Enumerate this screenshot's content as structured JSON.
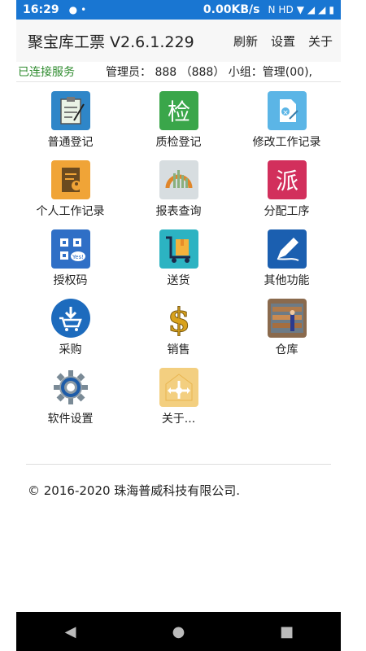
{
  "status_bar": {
    "time": "16:29",
    "speed": "0.00KB/s",
    "icons": [
      "chat-icon",
      "nfc-icon",
      "hd-icon",
      "wifi-icon",
      "signal-4g-icon",
      "signal-4g-icon-2",
      "battery-icon"
    ]
  },
  "app_bar": {
    "title": "聚宝库工票 V2.6.1.229",
    "refresh": "刷新",
    "settings": "设置",
    "about": "关于"
  },
  "info_bar": {
    "connection": "已连接服务",
    "admin": "管理员：  888 （888） 小组：管理(00),"
  },
  "menu": [
    {
      "label": "普通登记",
      "icon": "clipboard-icon",
      "bg": "#2f86c8"
    },
    {
      "label": "质检登记",
      "icon": "inspect-icon",
      "bg": "#3aa64a"
    },
    {
      "label": "修改工作记录",
      "icon": "edit-doc-icon",
      "bg": "#5bb5e6"
    },
    {
      "label": "个人工作记录",
      "icon": "person-record-icon",
      "bg": "#f0a437"
    },
    {
      "label": "报表查询",
      "icon": "report-icon",
      "bg": "#d7dde0"
    },
    {
      "label": "分配工序",
      "icon": "dispatch-icon",
      "bg": "#d22f5c"
    },
    {
      "label": "授权码",
      "icon": "qrcode-icon",
      "bg": "#2f6fc6"
    },
    {
      "label": "送货",
      "icon": "cart-icon",
      "bg": "#2cb3c2"
    },
    {
      "label": "其他功能",
      "icon": "pen-icon",
      "bg": "#1b5fb0"
    },
    {
      "label": "采购",
      "icon": "shopping-cart-icon",
      "bg": "#1d6bbd"
    },
    {
      "label": "销售",
      "icon": "dollar-icon",
      "bg": "#ffffff"
    },
    {
      "label": "仓库",
      "icon": "warehouse-icon",
      "bg": "#8a6a4d"
    },
    {
      "label": "软件设置",
      "icon": "gear-icon",
      "bg": "#ffffff"
    },
    {
      "label": "关于...",
      "icon": "about-icon",
      "bg": "#f3cf80"
    }
  ],
  "footer": {
    "copyright": "© 2016-2020 珠海普威科技有限公司."
  },
  "nav": {
    "back": "◀",
    "home": "●",
    "recent": "■"
  }
}
